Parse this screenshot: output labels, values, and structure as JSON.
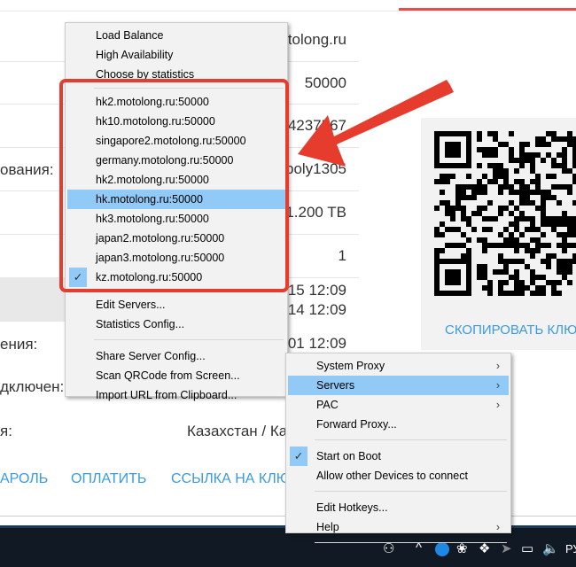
{
  "page": {
    "values": [
      "otolong.ru",
      "50000",
      "4237567",
      "poly1305",
      "1.200 TB",
      "1",
      "-15 12:09",
      "3-14 12:09",
      "2-01 12:09"
    ],
    "labels": [
      "ования:",
      "ения:",
      "дключен:",
      "я:"
    ],
    "country": "Казахстан / Ка",
    "links": [
      "АРОЛЬ",
      "ОПЛАТИТЬ",
      "ССЫЛКА НА КЛЮЧ"
    ],
    "copy_key": "СКОПИРОВАТЬ КЛЮ"
  },
  "servers_menu": {
    "modes": [
      "Load Balance",
      "High Availability",
      "Choose by statistics"
    ],
    "servers": [
      {
        "label": "hk2.motolong.ru:50000"
      },
      {
        "label": "hk10.motolong.ru:50000"
      },
      {
        "label": "singapore2.motolong.ru:50000"
      },
      {
        "label": "germany.motolong.ru:50000"
      },
      {
        "label": "hk2.motolong.ru:50000"
      },
      {
        "label": "hk.motolong.ru:50000",
        "hover": true
      },
      {
        "label": "hk3.motolong.ru:50000"
      },
      {
        "label": "japan2.motolong.ru:50000"
      },
      {
        "label": "japan3.motolong.ru:50000"
      },
      {
        "label": "kz.motolong.ru:50000",
        "checked": true
      }
    ],
    "edit": [
      "Edit Servers...",
      "Statistics Config..."
    ],
    "share": [
      "Share Server Config...",
      "Scan QRCode from Screen...",
      "Import URL from Clipboard..."
    ]
  },
  "tray_menu": {
    "items": [
      {
        "label": "System Proxy",
        "submenu": true
      },
      {
        "label": "Servers",
        "submenu": true,
        "hover": true
      },
      {
        "label": "PAC",
        "submenu": true
      },
      {
        "label": "Forward Proxy..."
      },
      {
        "sep": true
      },
      {
        "label": "Start on Boot",
        "checked": true
      },
      {
        "label": "Allow other Devices to connect"
      },
      {
        "sep": true
      },
      {
        "label": "Edit Hotkeys..."
      },
      {
        "label": "Help",
        "submenu": true
      },
      {
        "sep": true
      }
    ]
  },
  "taskbar": {
    "lang": "РУ"
  },
  "colors": {
    "highlight": "#91c9f7",
    "annotation": "#e53c2e",
    "link": "#3a9be0"
  }
}
